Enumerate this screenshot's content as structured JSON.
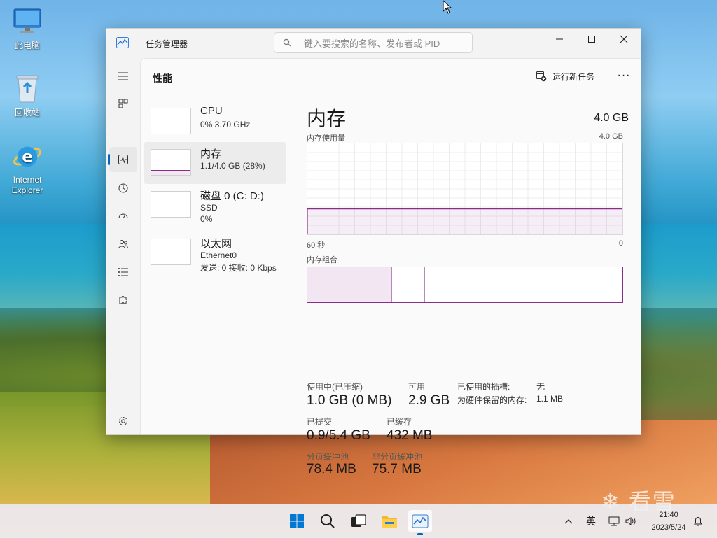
{
  "desktop": {
    "icons": [
      {
        "label": "此电脑"
      },
      {
        "label": "回收站"
      },
      {
        "label": "Internet Explorer"
      }
    ]
  },
  "window": {
    "title": "任务管理器",
    "search_placeholder": "键入要搜索的名称、发布者或 PID"
  },
  "header": {
    "page_title": "性能",
    "run_new_task": "运行新任务",
    "more": "···"
  },
  "devices": [
    {
      "name": "CPU",
      "line2": "0% 3.70 GHz",
      "line3": ""
    },
    {
      "name": "内存",
      "line2": "1.1/4.0 GB (28%)",
      "line3": ""
    },
    {
      "name": "磁盘 0 (C: D:)",
      "line2": "SSD",
      "line3": "0%"
    },
    {
      "name": "以太网",
      "line2": "Ethernet0",
      "line3": "发送: 0 接收: 0 Kbps"
    }
  ],
  "detail": {
    "title": "内存",
    "total": "4.0 GB",
    "usage_label": "内存使用量",
    "usage_max": "4.0 GB",
    "time_left": "60 秒",
    "time_right": "0",
    "composition_label": "内存组合",
    "usage_fraction": 0.28,
    "stats": {
      "in_use_label": "使用中(已压缩)",
      "in_use_value": "1.0 GB (0 MB)",
      "available_label": "可用",
      "available_value": "2.9 GB",
      "committed_label": "已提交",
      "committed_value": "0.9/5.4 GB",
      "cached_label": "已缓存",
      "cached_value": "432 MB",
      "paged_label": "分页缓冲池",
      "paged_value": "78.4 MB",
      "nonpaged_label": "非分页缓冲池",
      "nonpaged_value": "75.7 MB",
      "slots_label": "已使用的插槽:",
      "slots_value": "无",
      "reserved_label": "为硬件保留的内存:",
      "reserved_value": "1.1 MB"
    }
  },
  "taskbar": {
    "lang": "英",
    "time": "21:40",
    "date": "2023/5/24"
  },
  "watermark": "看雪",
  "colors": {
    "accent": "#0067c0",
    "memory": "#8a2c8a"
  }
}
